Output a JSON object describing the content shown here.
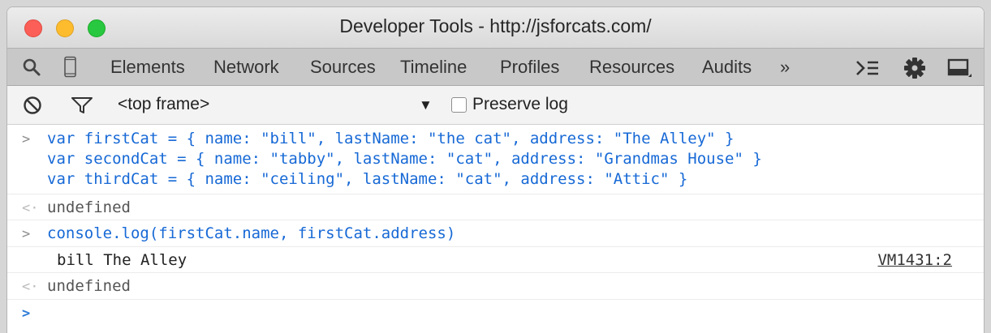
{
  "window": {
    "title": "Developer Tools - http://jsforcats.com/"
  },
  "toolbar": {
    "tabs": [
      "Elements",
      "Network",
      "Sources",
      "Timeline",
      "Profiles",
      "Resources",
      "Audits"
    ],
    "more": "»",
    "icons": [
      "search-icon",
      "device-mode-icon",
      "console-drawer-icon",
      "settings-gear-icon",
      "dock-side-icon"
    ]
  },
  "filterbar": {
    "frame": "<top frame>",
    "dropdown_arrow": "▼",
    "preserve_log": "Preserve log",
    "preserve_log_checked": false
  },
  "console": {
    "input1": [
      "var firstCat = { name: \"bill\", lastName: \"the cat\", address: \"The Alley\" }",
      "var secondCat = { name: \"tabby\", lastName: \"cat\", address: \"Grandmas House\" }",
      "var thirdCat = { name: \"ceiling\", lastName: \"cat\", address: \"Attic\" }"
    ],
    "result1": "undefined",
    "input2": "console.log(firstCat.name, firstCat.address)",
    "log_output": "bill The Alley",
    "log_source": "VM1431:2",
    "result2": "undefined",
    "prompt_in": ">",
    "prompt_out": "<·",
    "prompt_active": ">"
  }
}
